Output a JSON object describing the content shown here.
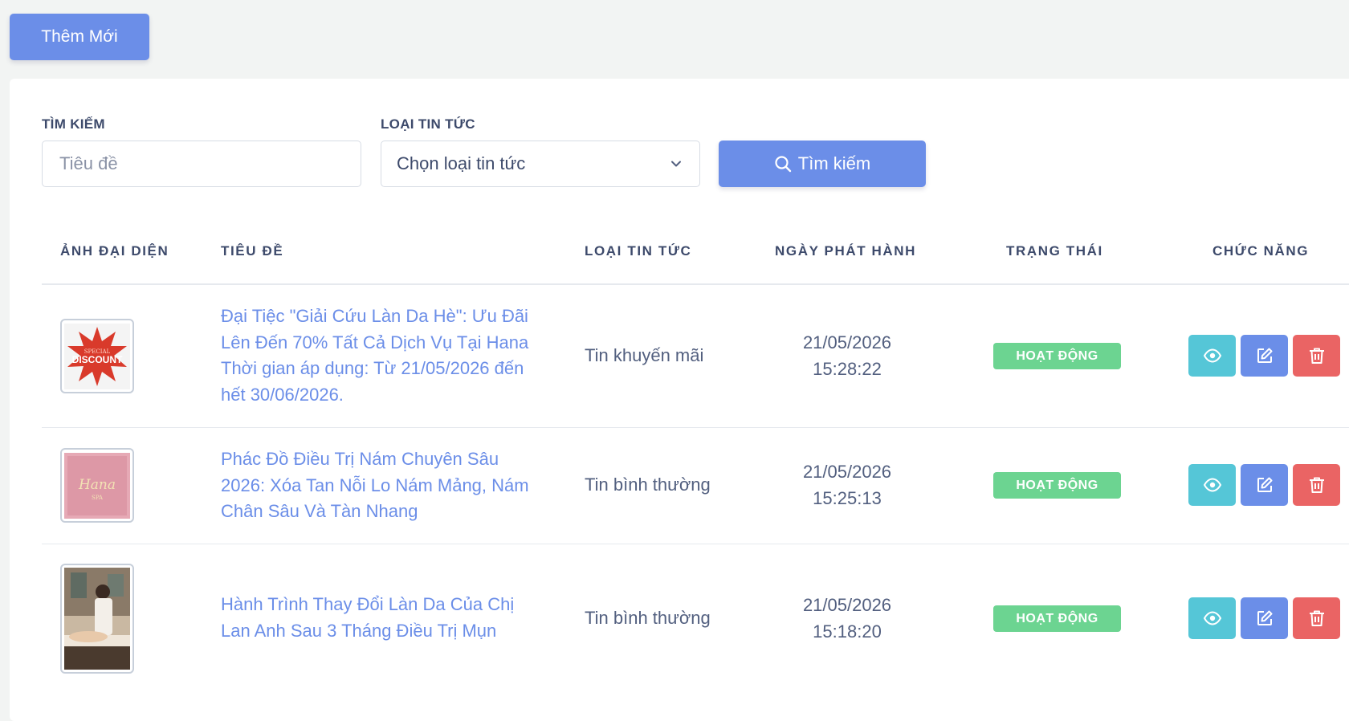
{
  "toolbar": {
    "add_label": "Thêm Mới"
  },
  "filters": {
    "search_label": "TÌM KIẾM",
    "search_placeholder": "Tiêu đề",
    "category_label": "LOẠI TIN TỨC",
    "category_value": "Chọn loại tin tức",
    "search_button": "Tìm kiếm"
  },
  "table": {
    "headers": [
      "ẢNH ĐẠI DIỆN",
      "TIÊU ĐỀ",
      "LOẠI TIN TỨC",
      "NGÀY PHÁT HÀNH",
      "TRẠNG THÁI",
      "CHỨC NĂNG"
    ],
    "rows": [
      {
        "title": "Đại Tiệc \"Giải Cứu Làn Da Hè\": Ưu Đãi Lên Đến 70% Tất Cả Dịch Vụ Tại Hana Thời gian áp dụng: Từ 21/05/2026 đến hết 30/06/2026.",
        "category": "Tin khuyến mãi",
        "date": "21/05/2026",
        "time": "15:28:22",
        "status": "HOẠT ĐỘNG",
        "thumb": {
          "line1": "SPECIAL",
          "line2": "DISCOUNT"
        }
      },
      {
        "title": "Phác Đồ Điều Trị Nám Chuyên Sâu 2026: Xóa Tan Nỗi Lo Nám Mảng, Nám Chân Sâu Và Tàn Nhang",
        "category": "Tin bình thường",
        "date": "21/05/2026",
        "time": "15:25:13",
        "status": "HOẠT ĐỘNG",
        "thumb": {
          "line1": "Hana",
          "line2": "SPA"
        }
      },
      {
        "title": "Hành Trình Thay Đổi Làn Da Của Chị Lan Anh Sau 3 Tháng Điều Trị Mụn",
        "category": "Tin bình thường",
        "date": "21/05/2026",
        "time": "15:18:20",
        "status": "HOẠT ĐỘNG"
      }
    ]
  },
  "colors": {
    "primary": "#6b8ee8",
    "info": "#55c6d7",
    "danger": "#ea6464",
    "success": "#6cd491"
  },
  "icons": {
    "search": "search-icon",
    "chevron": "chevron-down-icon",
    "view": "eye-icon",
    "edit": "edit-icon",
    "delete": "trash-icon"
  }
}
